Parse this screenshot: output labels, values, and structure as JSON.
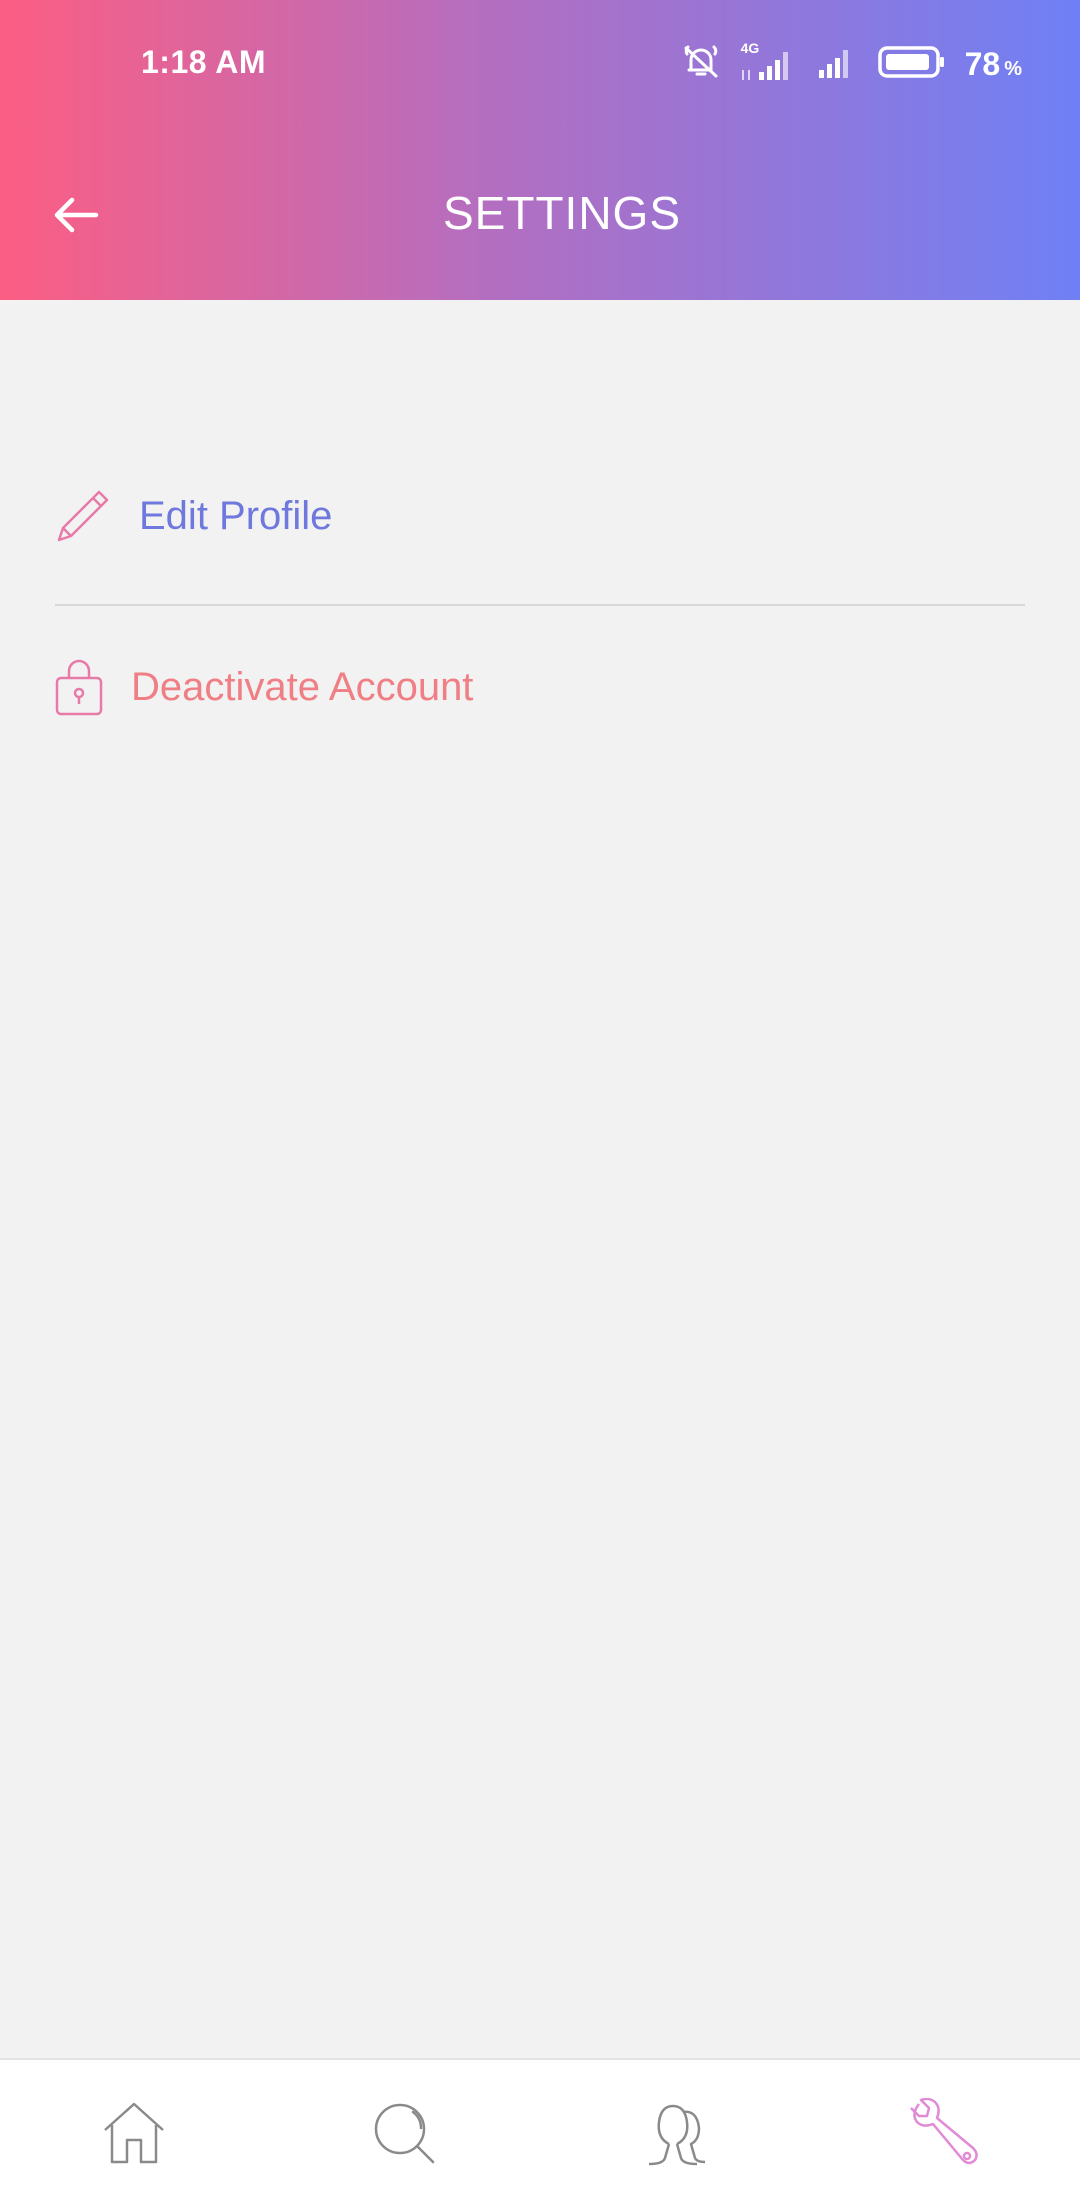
{
  "status_bar": {
    "time": "1:18 AM",
    "network": "4G",
    "battery_level": "78",
    "battery_unit": "%",
    "icons": [
      "alarm-off-icon",
      "signal-4g-icon",
      "signal-icon",
      "battery-icon"
    ]
  },
  "header": {
    "title": "SETTINGS",
    "back_icon": "arrow-left-icon"
  },
  "menu": {
    "items": [
      {
        "label": "Edit Profile",
        "icon": "pencil-icon",
        "color": "#6f78dc"
      },
      {
        "label": "Deactivate Account",
        "icon": "lock-icon",
        "color": "#f07f85"
      }
    ]
  },
  "bottom_nav": {
    "items": [
      {
        "name": "home",
        "icon": "home-icon",
        "active": false
      },
      {
        "name": "search",
        "icon": "search-icon",
        "active": false
      },
      {
        "name": "people",
        "icon": "people-icon",
        "active": false
      },
      {
        "name": "settings",
        "icon": "wrench-icon",
        "active": true
      }
    ]
  },
  "colors": {
    "gradient_start": "#fc5e83",
    "gradient_mid": "#b46ec0",
    "gradient_end": "#6f80f5",
    "background": "#f2f2f2",
    "icon_pink": "#e87aa8",
    "nav_inactive": "#8a8a8a",
    "nav_active": "#e28ad6"
  }
}
